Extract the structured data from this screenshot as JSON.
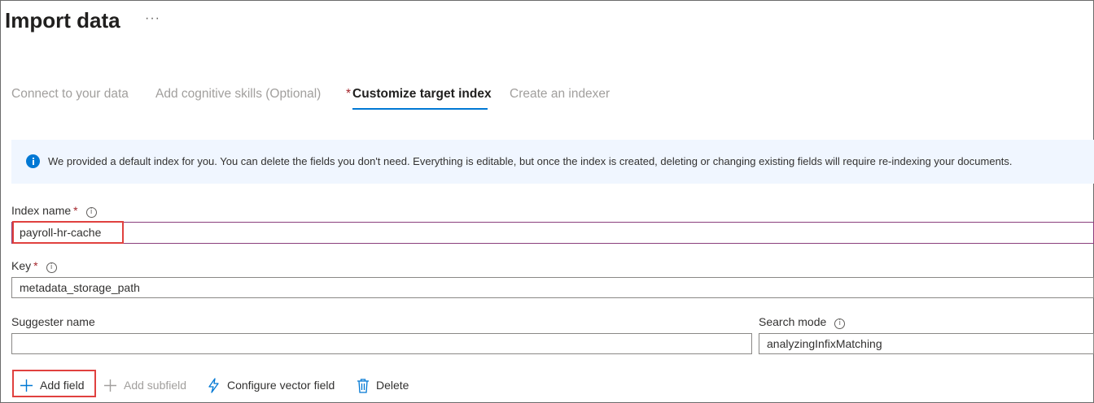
{
  "header": {
    "title": "Import data",
    "more_label": "···"
  },
  "tabs": [
    {
      "label": "Connect to your data",
      "active": false
    },
    {
      "label": "Add cognitive skills (Optional)",
      "active": false
    },
    {
      "label": "Customize target index",
      "active": true,
      "required_mark": "*"
    },
    {
      "label": "Create an indexer",
      "active": false
    }
  ],
  "banner": {
    "text": "We provided a default index for you. You can delete the fields you don't need. Everything is editable, but once the index is created, deleting or changing existing fields will require re-indexing your documents."
  },
  "form": {
    "index_name": {
      "label": "Index name",
      "required_mark": "*",
      "value": "payroll-hr-cache"
    },
    "key": {
      "label": "Key",
      "required_mark": "*",
      "value": "metadata_storage_path"
    },
    "suggester_name": {
      "label": "Suggester name",
      "value": ""
    },
    "search_mode": {
      "label": "Search mode",
      "value": "analyzingInfixMatching"
    }
  },
  "toolbar": {
    "add_field": "Add field",
    "add_subfield": "Add subfield",
    "configure_vector_field": "Configure vector field",
    "delete": "Delete"
  },
  "colors": {
    "accent": "#0078d4",
    "highlight": "#e0413f",
    "required": "#a4262c",
    "banner_bg": "#f0f6ff"
  }
}
